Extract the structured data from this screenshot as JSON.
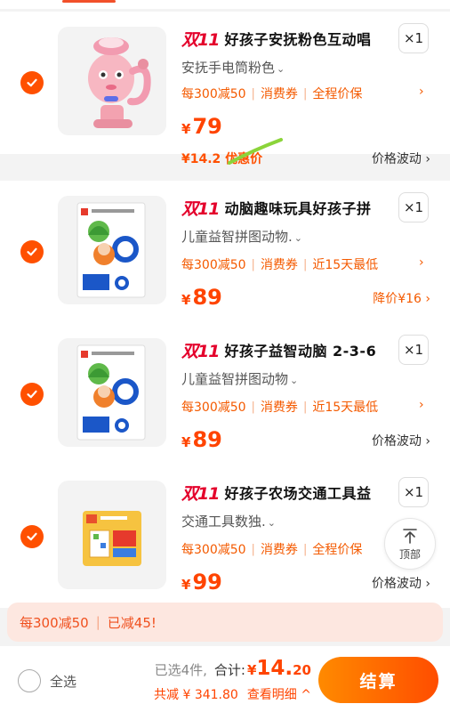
{
  "cart": {
    "items": [
      {
        "tag": "双11",
        "title": "好孩子安抚粉色互动唱",
        "spec": "安抚手电筒粉色",
        "promo": [
          "每300减50",
          "消费券",
          "全程价保"
        ],
        "currency": "¥",
        "price": "79",
        "sub_price": "¥14.2 优惠价",
        "right_note": "价格波动",
        "qty": "×1"
      },
      {
        "tag": "双11",
        "title": "动脑趣味玩具好孩子拼",
        "spec": "儿童益智拼图动物.",
        "promo": [
          "每300减50",
          "消费券",
          "近15天最低"
        ],
        "currency": "¥",
        "price": "89",
        "right_note": "降价¥16",
        "qty": "×1"
      },
      {
        "tag": "双11",
        "title": "好孩子益智动脑 2-3-6",
        "spec": "儿童益智拼图动物",
        "promo": [
          "每300减50",
          "消费券",
          "近15天最低"
        ],
        "currency": "¥",
        "price": "89",
        "right_note": "价格波动",
        "qty": "×1"
      },
      {
        "tag": "双11",
        "title": "好孩子农场交通工具益",
        "spec": "交通工具数独.",
        "promo": [
          "每300减50",
          "消费券",
          "全程价保"
        ],
        "currency": "¥",
        "price": "99",
        "right_note": "价格波动",
        "qty": "×1"
      }
    ]
  },
  "back_top_label": "顶部",
  "discount_bar": {
    "rule": "每300减50",
    "reduced": "已减45!"
  },
  "footer": {
    "select_all": "全选",
    "selected_count": "已选4件,",
    "total_label": "合计:",
    "currency": "¥",
    "total_int": "14.",
    "total_dec": "20",
    "saved": "共减 ¥ 341.80",
    "detail": "查看明细",
    "checkout": "结算"
  },
  "colors": {
    "accent": "#ff5000",
    "promo": "#f45a00",
    "tag": "#e4002b",
    "discount_bg": "#fde7e0"
  }
}
